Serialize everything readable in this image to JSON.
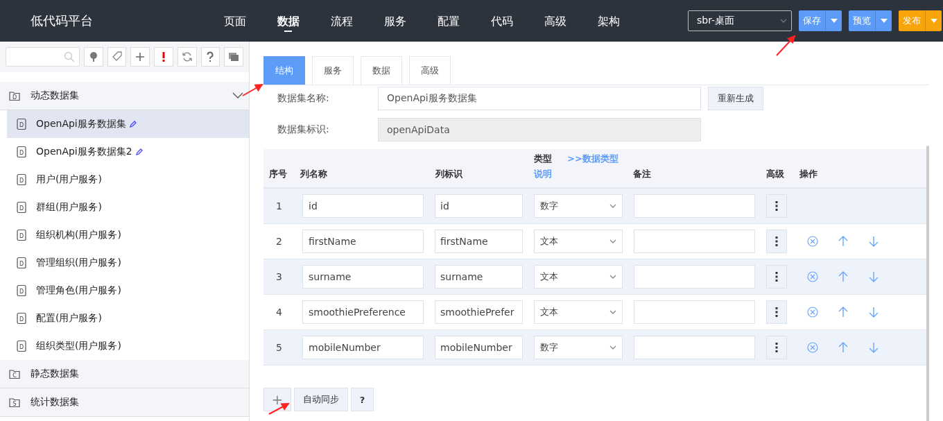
{
  "header": {
    "logo": "低代码平台",
    "nav": [
      {
        "label": "页面",
        "selected": false
      },
      {
        "label": "数据",
        "selected": true
      },
      {
        "label": "流程",
        "selected": false
      },
      {
        "label": "服务",
        "selected": false
      },
      {
        "label": "配置",
        "selected": false
      },
      {
        "label": "代码",
        "selected": false
      },
      {
        "label": "高级",
        "selected": false
      },
      {
        "label": "架构",
        "selected": false
      }
    ],
    "app_select": "sbr-桌面",
    "actions": [
      {
        "label": "保存",
        "kind": "primary"
      },
      {
        "label": "预览",
        "kind": "primary"
      },
      {
        "label": "发布",
        "kind": "warning"
      }
    ]
  },
  "sidebar": {
    "toolbar": [
      {
        "kind": "tree"
      },
      {
        "kind": "tag"
      },
      {
        "kind": "plus"
      },
      {
        "kind": "alert"
      },
      {
        "kind": "refresh"
      },
      {
        "kind": "help"
      },
      {
        "kind": "windows"
      }
    ],
    "groups": [
      {
        "label": "动态数据集",
        "icon_letter": "D",
        "expanded": true,
        "items": [
          {
            "label": "OpenApi服务数据集",
            "icon_letter": "D",
            "editable": true,
            "selected": true
          },
          {
            "label": "OpenApi服务数据集2",
            "icon_letter": "D",
            "editable": true,
            "selected": false
          },
          {
            "label": "用户(用户服务)",
            "icon_letter": "D",
            "editable": false,
            "selected": false
          },
          {
            "label": "群组(用户服务)",
            "icon_letter": "D",
            "editable": false,
            "selected": false
          },
          {
            "label": "组织机构(用户服务)",
            "icon_letter": "D",
            "editable": false,
            "selected": false
          },
          {
            "label": "管理组织(用户服务)",
            "icon_letter": "D",
            "editable": false,
            "selected": false
          },
          {
            "label": "管理角色(用户服务)",
            "icon_letter": "D",
            "editable": false,
            "selected": false
          },
          {
            "label": "配置(用户服务)",
            "icon_letter": "D",
            "editable": false,
            "selected": false
          },
          {
            "label": "组织类型(用户服务)",
            "icon_letter": "D",
            "editable": false,
            "selected": false
          }
        ]
      },
      {
        "label": "静态数据集",
        "icon_letter": "C",
        "expanded": false
      },
      {
        "label": "统计数据集",
        "icon_letter": "S",
        "expanded": false
      }
    ]
  },
  "tabs": [
    {
      "label": "结构",
      "selected": true
    },
    {
      "label": "服务",
      "selected": false
    },
    {
      "label": "数据",
      "selected": false
    },
    {
      "label": "高级",
      "selected": false
    }
  ],
  "form": {
    "name_label": "数据集名称:",
    "name_value": "OpenApi服务数据集",
    "regenerate_button": "重新生成",
    "id_label": "数据集标识:",
    "id_value": "openApiData"
  },
  "table": {
    "columns": {
      "index": "序号",
      "name": "列名称",
      "id": "列标识",
      "type": "类型",
      "type_help": "说明",
      "type_link": ">>数据类型",
      "note": "备注",
      "advanced": "高级",
      "actions": "操作"
    },
    "rows": [
      {
        "index": "1",
        "name": "id",
        "id": "id",
        "type": "数字",
        "note": "",
        "movable": false
      },
      {
        "index": "2",
        "name": "firstName",
        "id": "firstName",
        "type": "文本",
        "note": "",
        "movable": true
      },
      {
        "index": "3",
        "name": "surname",
        "id": "surname",
        "type": "文本",
        "note": "",
        "movable": true
      },
      {
        "index": "4",
        "name": "smoothiePreference",
        "id": "smoothiePrefer",
        "type": "文本",
        "note": "",
        "movable": true
      },
      {
        "index": "5",
        "name": "mobileNumber",
        "id": "mobileNumber",
        "type": "数字",
        "note": "",
        "movable": true
      }
    ]
  },
  "footer": {
    "add_icon": "+",
    "sync_button": "自动同步",
    "help_button": "?"
  }
}
